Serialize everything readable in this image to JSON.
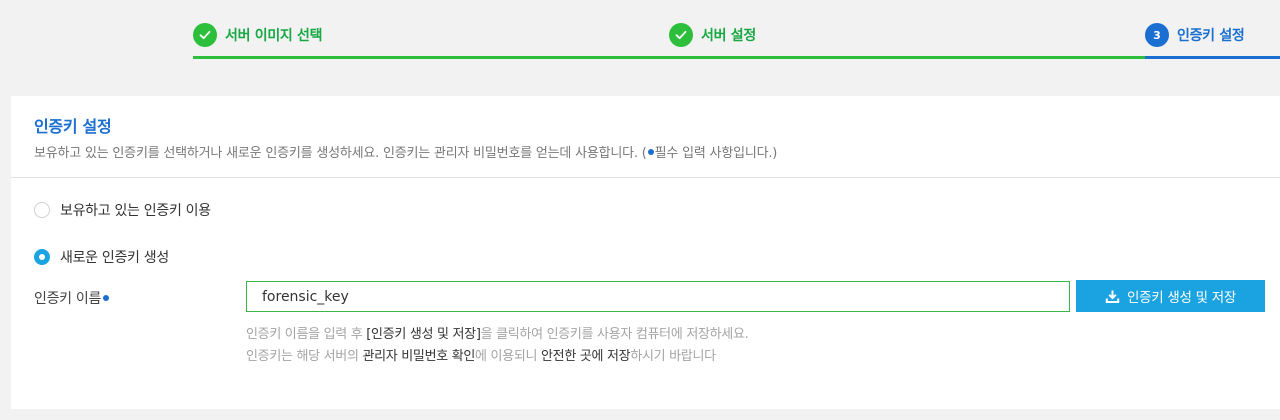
{
  "stepper": {
    "steps": [
      {
        "label": "서버 이미지 선택",
        "status": "done"
      },
      {
        "label": "서버 설정",
        "status": "done"
      },
      {
        "number": "3",
        "label": "인증키 설정",
        "status": "active"
      }
    ]
  },
  "colors": {
    "done": "#2dbe3c",
    "active": "#1a6fd0",
    "button": "#1aa3e0"
  },
  "card": {
    "title": "인증키 설정",
    "description_main": "보유하고 있는 인증키를 선택하거나 새로운 인증키를 생성하세요. 인증키는 관리자 비밀번호를 얻는데 사용합니다. (",
    "description_required": "필수 입력 사항입니다.)"
  },
  "options": {
    "existing": {
      "label": "보유하고 있는 인증키 이용",
      "selected": false
    },
    "new": {
      "label": "새로운 인증키 생성",
      "selected": true
    }
  },
  "key_name": {
    "label": "인증키 이름",
    "value": "forensic_key",
    "button_label": "인증키 생성 및 저장",
    "button_icon": "download-icon"
  },
  "help": {
    "line1": {
      "before": "인증키 이름을 입력 후 ",
      "em": "[인증키 생성 및 저장]",
      "after": "을 클릭하여 인증키를 사용자 컴퓨터에 저장하세요."
    },
    "line2": {
      "part1": "인증키는 해당 서버의 ",
      "em1": "관리자 비밀번호 확인",
      "part2": "에 이용되니 ",
      "em2": "안전한 곳에 저장",
      "part3": "하시기 바랍니다"
    }
  }
}
